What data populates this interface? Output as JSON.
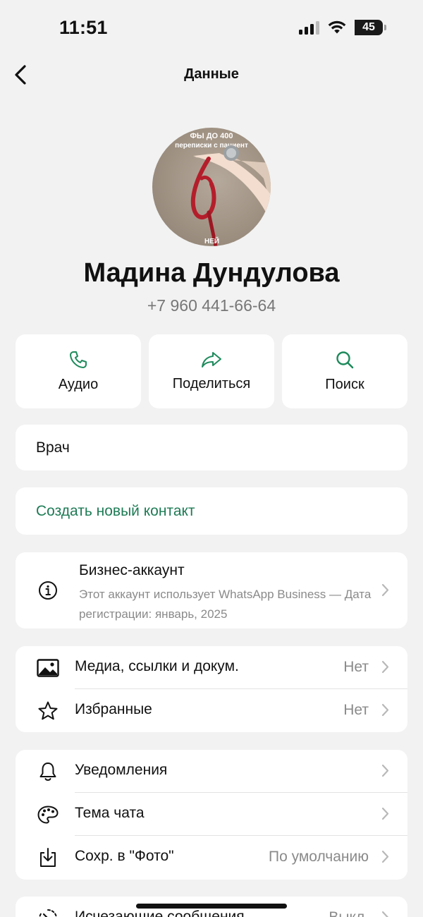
{
  "status_bar": {
    "time": "11:51",
    "battery": "45"
  },
  "header": {
    "title": "Данные"
  },
  "avatar_text": {
    "line1": "ФЫ ДО 400",
    "line2": "переписки с пациент",
    "line3": "НЕЙ"
  },
  "contact": {
    "name": "Мадина Дундулова",
    "phone": "+7 960 441-66-64"
  },
  "actions": [
    {
      "label": "Аудио",
      "icon": "phone-icon"
    },
    {
      "label": "Поделиться",
      "icon": "share-icon"
    },
    {
      "label": "Поиск",
      "icon": "search-icon"
    }
  ],
  "about": "Врач",
  "new_contact": "Создать новый контакт",
  "business": {
    "title": "Бизнес-аккаунт",
    "description": "Этот аккаунт использует WhatsApp Business — Дата регистрации: январь, 2025"
  },
  "media_rows": [
    {
      "label": "Медиа, ссылки и докум.",
      "value": "Нет",
      "icon": "image-icon"
    },
    {
      "label": "Избранные",
      "value": "Нет",
      "icon": "star-icon"
    }
  ],
  "settings_rows": [
    {
      "label": "Уведомления",
      "value": "",
      "icon": "bell-icon"
    },
    {
      "label": "Тема чата",
      "value": "",
      "icon": "palette-icon"
    },
    {
      "label": "Сохр. в \"Фото\"",
      "value": "По умолчанию",
      "icon": "download-icon"
    }
  ],
  "disappearing": {
    "label": "Исчезающие сообщения",
    "value": "Выкл."
  },
  "colors": {
    "accent": "#1e7b55",
    "background": "#f2f2f2",
    "card": "#ffffff",
    "secondary_text": "#8a8a8a"
  }
}
